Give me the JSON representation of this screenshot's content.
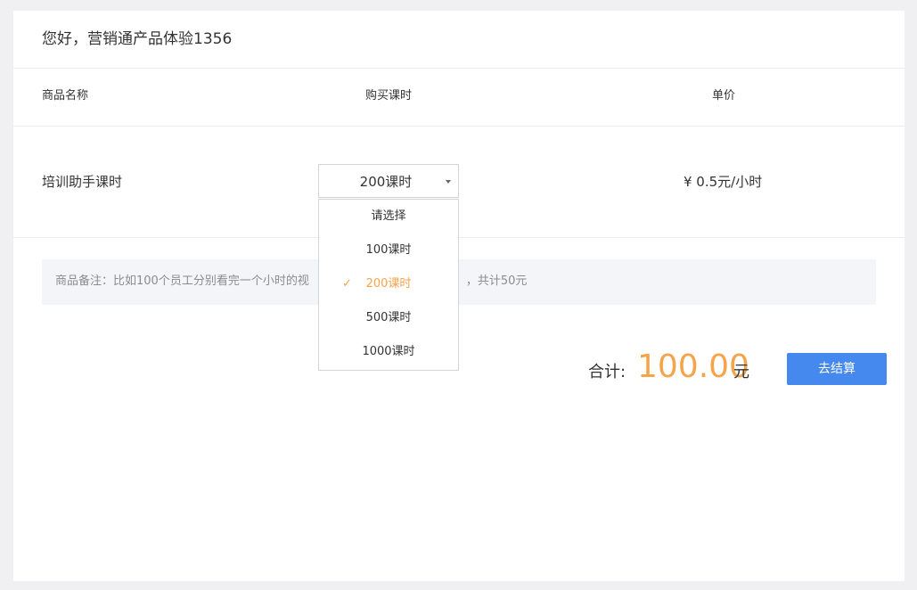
{
  "header": {
    "greeting": "您好，营销通产品体验1356"
  },
  "table": {
    "columns": [
      "商品名称",
      "购买课时",
      "单价"
    ],
    "row": {
      "product_name": "培训助手课时",
      "selected_hours": "200课时",
      "unit_price": "¥ 0.5元/小时"
    }
  },
  "note": {
    "text": "商品备注：比如100个员工分别看完一个小时的视频课程，则消耗100课时，共计50元",
    "text_left": "商品备注：比如100个员工分别看完一个小时的视",
    "text_right": "，共计50元"
  },
  "dropdown": {
    "options": [
      "请选择",
      "100课时",
      "200课时",
      "500课时",
      "1000课时"
    ],
    "selected_index": 2,
    "check_glyph": "✓"
  },
  "summary": {
    "total_label": "合计:",
    "total_amount": "100.00",
    "total_unit": "元",
    "checkout_label": "去结算"
  },
  "colors": {
    "accent": "#f6a34a",
    "primary_button": "#4589ee",
    "page_bg": "#f0f0f2",
    "note_bg": "#f4f5f9"
  }
}
